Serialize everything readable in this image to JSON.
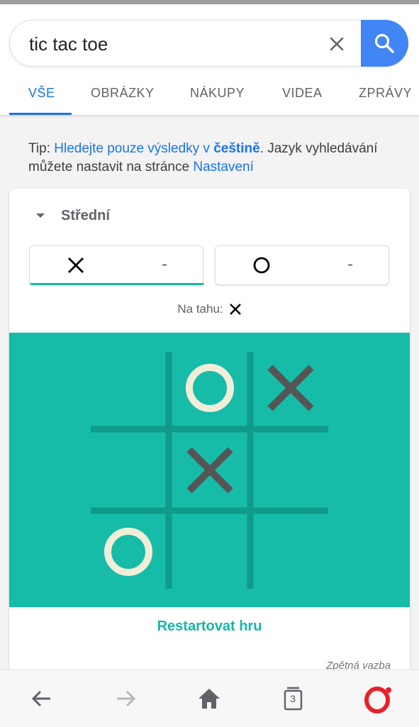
{
  "search": {
    "query": "tic tac toe",
    "clear_icon": "close-icon",
    "search_icon": "search-icon",
    "accent": "#4285f4"
  },
  "tabs": [
    {
      "label": "VŠE",
      "active": true
    },
    {
      "label": "OBRÁZKY"
    },
    {
      "label": "NÁKUPY"
    },
    {
      "label": "VIDEA"
    },
    {
      "label": "ZPRÁVY"
    }
  ],
  "tip": {
    "prefix": "Tip: ",
    "link_text": "Hledejte pouze výsledky v ",
    "link_bold": "češtině",
    "middle": ". Jazyk vyhledávání můžete nastavit na stránce ",
    "settings_link": "Nastavení"
  },
  "game": {
    "difficulty": "Střední",
    "players": [
      {
        "symbol": "X",
        "score": "-",
        "active": true
      },
      {
        "symbol": "O",
        "score": "-",
        "active": false
      }
    ],
    "turn_label": "Na tahu:",
    "turn_symbol": "X",
    "board": [
      [
        "",
        "O",
        "X"
      ],
      [
        "",
        "X",
        ""
      ],
      [
        "O",
        "",
        ""
      ]
    ],
    "board_color": "#16bca8",
    "restart_label": "Restartovat hru",
    "feedback_label": "Zpětná vazba"
  },
  "bottom_nav": {
    "items": [
      "back-icon",
      "forward-icon",
      "home-icon",
      "tabs-icon",
      "opera-icon"
    ],
    "tabs_count": "3"
  }
}
